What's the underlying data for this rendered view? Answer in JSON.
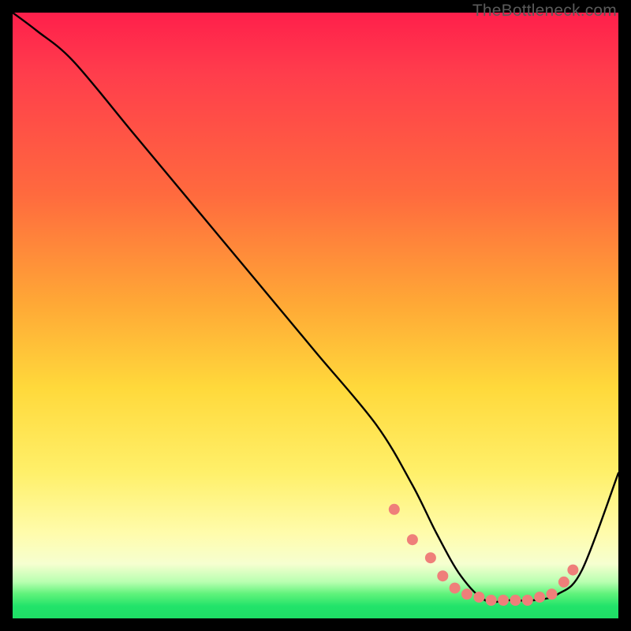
{
  "watermark": "TheBottleneck.com",
  "chart_data": {
    "type": "line",
    "title": "",
    "xlabel": "",
    "ylabel": "",
    "xlim": [
      0,
      100
    ],
    "ylim": [
      0,
      100
    ],
    "series": [
      {
        "name": "curve",
        "x": [
          0,
          4,
          10,
          20,
          30,
          40,
          50,
          60,
          66,
          70,
          74,
          78,
          82,
          86,
          90,
          94,
          100
        ],
        "y": [
          100,
          97,
          92,
          80,
          68,
          56,
          44,
          32,
          22,
          14,
          7,
          3,
          3,
          3,
          4,
          8,
          24
        ]
      }
    ],
    "markers": {
      "name": "dots",
      "color": "#ef7f7a",
      "x": [
        63,
        66,
        69,
        71,
        73,
        75,
        77,
        79,
        81,
        83,
        85,
        87,
        89,
        91,
        92.5
      ],
      "y": [
        18,
        13,
        10,
        7,
        5,
        4,
        3.5,
        3,
        3,
        3,
        3,
        3.5,
        4,
        6,
        8
      ]
    }
  }
}
